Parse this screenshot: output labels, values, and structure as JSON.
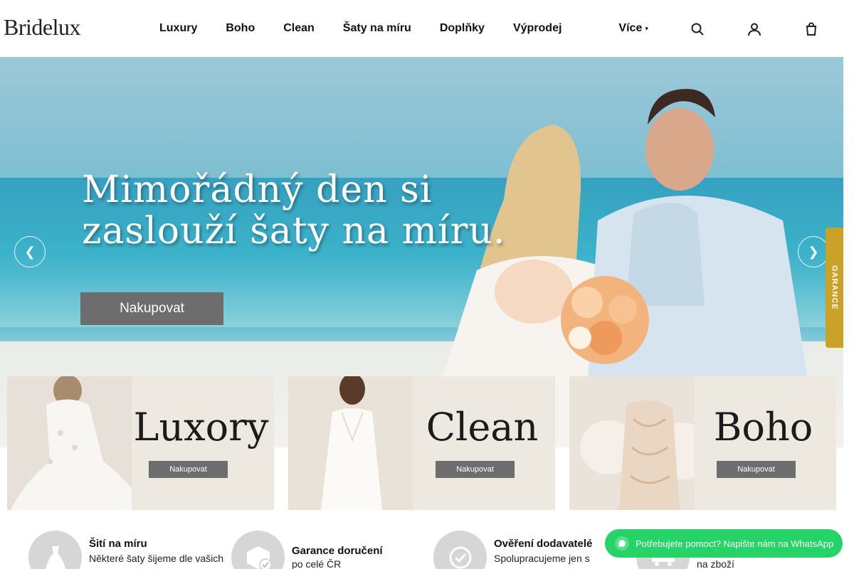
{
  "header": {
    "logo": "Bridelux",
    "nav": [
      "Luxury",
      "Boho",
      "Clean",
      "Šaty na míru",
      "Doplňky",
      "Výprodej"
    ],
    "more_label": "Více",
    "icons": [
      "search-icon",
      "account-icon",
      "cart-icon"
    ]
  },
  "hero": {
    "title_line1": "Mimořádný den si",
    "title_line2": "zaslouží šaty na míru.",
    "button_label": "Nakupovat",
    "prev_icon": "chevron-left-icon",
    "next_icon": "chevron-right-icon"
  },
  "guarantee_tab": {
    "label": "GARANCE"
  },
  "categories": [
    {
      "name": "Luxory",
      "button": "Nakupovat"
    },
    {
      "name": "Clean",
      "button": "Nakupovat"
    },
    {
      "name": "Boho",
      "button": "Nakupovat"
    }
  ],
  "features": [
    {
      "title": "Šití na míru",
      "text": "Některé šaty šijeme dle vašich",
      "icon": "dress-icon"
    },
    {
      "title": "Garance doručení",
      "text": "po celé ČR",
      "icon": "package-check-icon"
    },
    {
      "title": "Ověření dodavatelé",
      "text": "Spolupracujeme jen s",
      "icon": "verified-badge-icon"
    },
    {
      "title": "",
      "text": "na zboží",
      "icon": "delivery-truck-icon"
    }
  ],
  "whatsapp": {
    "label": "Potřebujete pomoct? Napište nám na WhatsApp"
  },
  "colors": {
    "button_gray": "#6d6d6d",
    "guarantee_gold": "#c9a227",
    "whatsapp_green": "#25d366",
    "card_beige": "#ede8e0"
  }
}
